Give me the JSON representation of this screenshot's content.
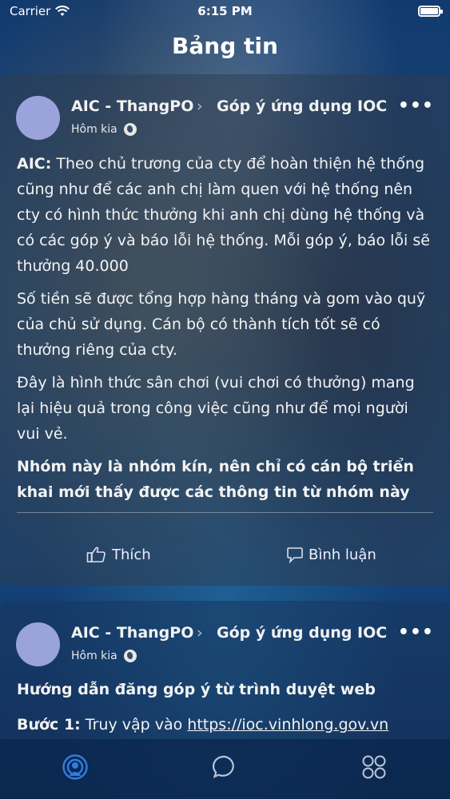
{
  "status_bar": {
    "carrier": "Carrier",
    "time": "6:15 PM"
  },
  "nav": {
    "title": "Bảng tin"
  },
  "posts": [
    {
      "author": "AIC - ThangPO",
      "group": "Góp ý ứng dụng IOC",
      "time": "Hôm kia",
      "paragraphs": [
        {
          "lead": "AIC:",
          "text": " Theo chủ trương của cty để hoàn thiện hệ thống cũng như để các anh chị làm quen với hệ thống nên cty có hình thức thưởng khi anh chị dùng hệ thống và có các góp ý và báo lỗi hệ thống. Mỗi góp ý, báo lỗi sẽ thưởng 40.000"
        },
        {
          "text": "Số tiền sẽ được tổng hợp hàng tháng và gom vào quỹ của chủ sử dụng. Cán bộ có thành tích tốt sẽ có thưởng riêng của cty."
        },
        {
          "text": "Đây là hình thức sân chơi (vui chơi có thưởng) mang lại hiệu quả trong công việc cũng như để mọi người vui vẻ."
        },
        {
          "text": "Nhóm này là nhóm kín, nên chỉ có cán bộ triển khai mới thấy được các thông tin từ nhóm này"
        }
      ],
      "like_label": "Thích",
      "comment_label": "Bình luận"
    },
    {
      "author": "AIC - ThangPO",
      "group": "Góp ý ứng dụng IOC",
      "time": "Hôm kia",
      "title": "Hướng dẫn đăng góp ý từ trình duyệt web",
      "step_label": "Bước 1:",
      "step_text": " Truy vập vào ",
      "step_link": "https://ioc.vinhlong.gov.vn"
    }
  ],
  "tabbar": {
    "icons": [
      "feed-icon",
      "chat-icon",
      "apps-icon"
    ],
    "active_color": "#2f7de1"
  }
}
